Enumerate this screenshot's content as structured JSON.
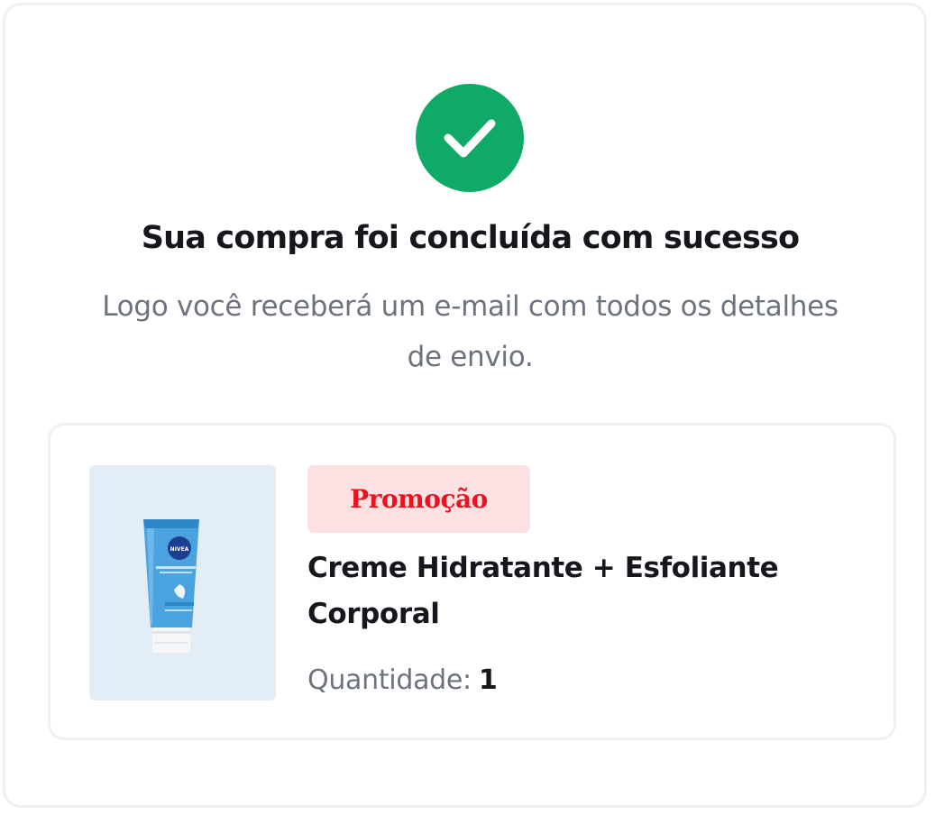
{
  "confirmation": {
    "icon": "check-icon",
    "title": "Sua compra foi concluída com sucesso",
    "message": "Logo você receberá um e-mail com todos os detalhes de envio."
  },
  "product": {
    "image": "nivea-tube-image",
    "badge": "Promoção",
    "name": "Creme Hidratante + Esfoliante Corporal",
    "quantity_label": "Quantidade:",
    "quantity": "1",
    "image_lettering": "NIVEA"
  },
  "colors": {
    "success": "#0fa968",
    "promo_text": "#e8131e",
    "promo_bg": "#fde1e2",
    "title_text": "#15171c",
    "muted_text": "#6c737c",
    "border": "#edf1f4",
    "thumb_bg": "#e3edf6"
  }
}
